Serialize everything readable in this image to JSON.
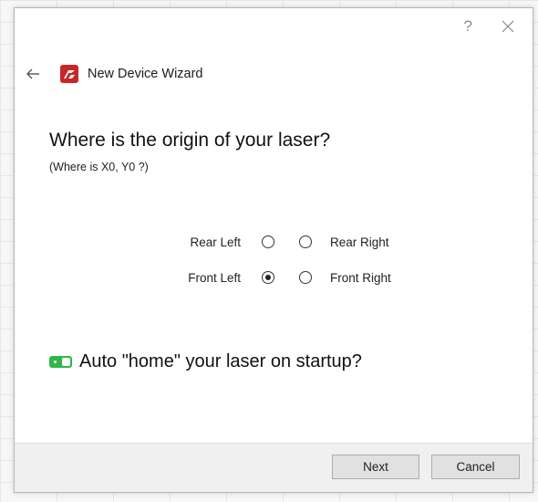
{
  "window": {
    "help_label": "?",
    "close_icon": "close-icon",
    "back_icon": "back-arrow-icon",
    "logo_icon": "app-logo-icon",
    "title": "New Device Wizard"
  },
  "question": {
    "title": "Where is the origin of your laser?",
    "subtitle": "(Where is X0, Y0 ?)"
  },
  "origin_options": {
    "rear_left": "Rear Left",
    "rear_right": "Rear Right",
    "front_left": "Front Left",
    "front_right": "Front Right",
    "selected": "Front Left"
  },
  "auto_home": {
    "label": "Auto \"home\" your laser on startup?",
    "enabled": true
  },
  "footer": {
    "next_label": "Next",
    "cancel_label": "Cancel"
  },
  "colors": {
    "toggle_on": "#2fb84a",
    "logo_red": "#c62828"
  }
}
